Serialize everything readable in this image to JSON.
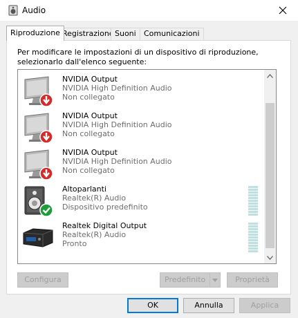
{
  "window": {
    "title": "Audio",
    "icon": "speaker-icon",
    "close_icon": "close-icon"
  },
  "tabs": [
    {
      "label": "Riproduzione",
      "active": true
    },
    {
      "label": "Registrazione",
      "active": false
    },
    {
      "label": "Suoni",
      "active": false
    },
    {
      "label": "Comunicazioni",
      "active": false
    }
  ],
  "instruction": "Per modificare le impostazioni di un dispositivo di riproduzione, selezionarlo dall'elenco seguente:",
  "devices": [
    {
      "name": "NVIDIA Output",
      "driver": "NVIDIA High Definition Audio",
      "status": "Non collegato",
      "icon": "monitor-icon",
      "badge": "disconnected-icon"
    },
    {
      "name": "NVIDIA Output",
      "driver": "NVIDIA High Definition Audio",
      "status": "Non collegato",
      "icon": "monitor-icon",
      "badge": "disconnected-icon"
    },
    {
      "name": "NVIDIA Output",
      "driver": "NVIDIA High Definition Audio",
      "status": "Non collegato",
      "icon": "monitor-icon",
      "badge": "disconnected-icon"
    },
    {
      "name": "Altoparlanti",
      "driver": "Realtek(R) Audio",
      "status": "Dispositivo predefinito",
      "icon": "speaker-icon",
      "badge": "default-check-icon"
    },
    {
      "name": "Realtek Digital Output",
      "driver": "Realtek(R) Audio",
      "status": "Pronto",
      "icon": "digital-output-icon",
      "badge": ""
    }
  ],
  "buttons": {
    "configure": "Configura",
    "set_default": "Predefinito",
    "properties": "Proprietà",
    "ok": "OK",
    "cancel": "Annulla",
    "apply": "Applica"
  },
  "colors": {
    "accent": "#0078d7",
    "disconnected": "#d42a2a",
    "default_ok": "#1f9b3a"
  }
}
